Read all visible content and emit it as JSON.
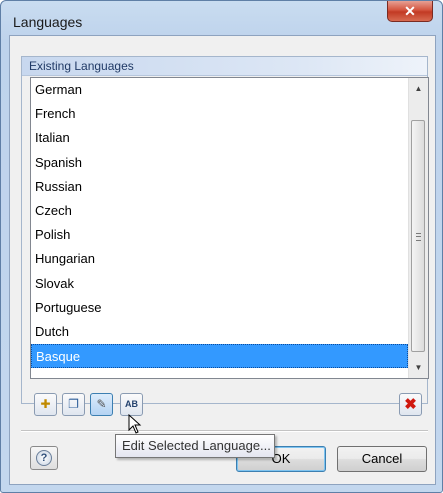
{
  "window": {
    "title": "Languages",
    "close_glyph": "✕"
  },
  "group": {
    "header": "Existing Languages"
  },
  "languages": [
    {
      "label": "German"
    },
    {
      "label": "French"
    },
    {
      "label": "Italian"
    },
    {
      "label": "Spanish"
    },
    {
      "label": "Russian"
    },
    {
      "label": "Czech"
    },
    {
      "label": "Polish"
    },
    {
      "label": "Hungarian"
    },
    {
      "label": "Slovak"
    },
    {
      "label": "Portuguese"
    },
    {
      "label": "Dutch"
    },
    {
      "label": "Basque",
      "selected": true
    }
  ],
  "toolbar": {
    "buttons": [
      {
        "icon": "new-language-icon",
        "glyph": "✚"
      },
      {
        "icon": "copy-language-icon",
        "glyph": "❐"
      },
      {
        "icon": "edit-language-icon",
        "glyph": "✎"
      },
      {
        "icon": "rename-language-icon",
        "glyph": "AB"
      }
    ],
    "delete_glyph": "✖"
  },
  "tooltip": "Edit Selected Language...",
  "footer": {
    "help_glyph": "?",
    "ok": "OK",
    "cancel": "Cancel"
  },
  "scrollbar": {
    "up": "▲",
    "down": "▼"
  }
}
